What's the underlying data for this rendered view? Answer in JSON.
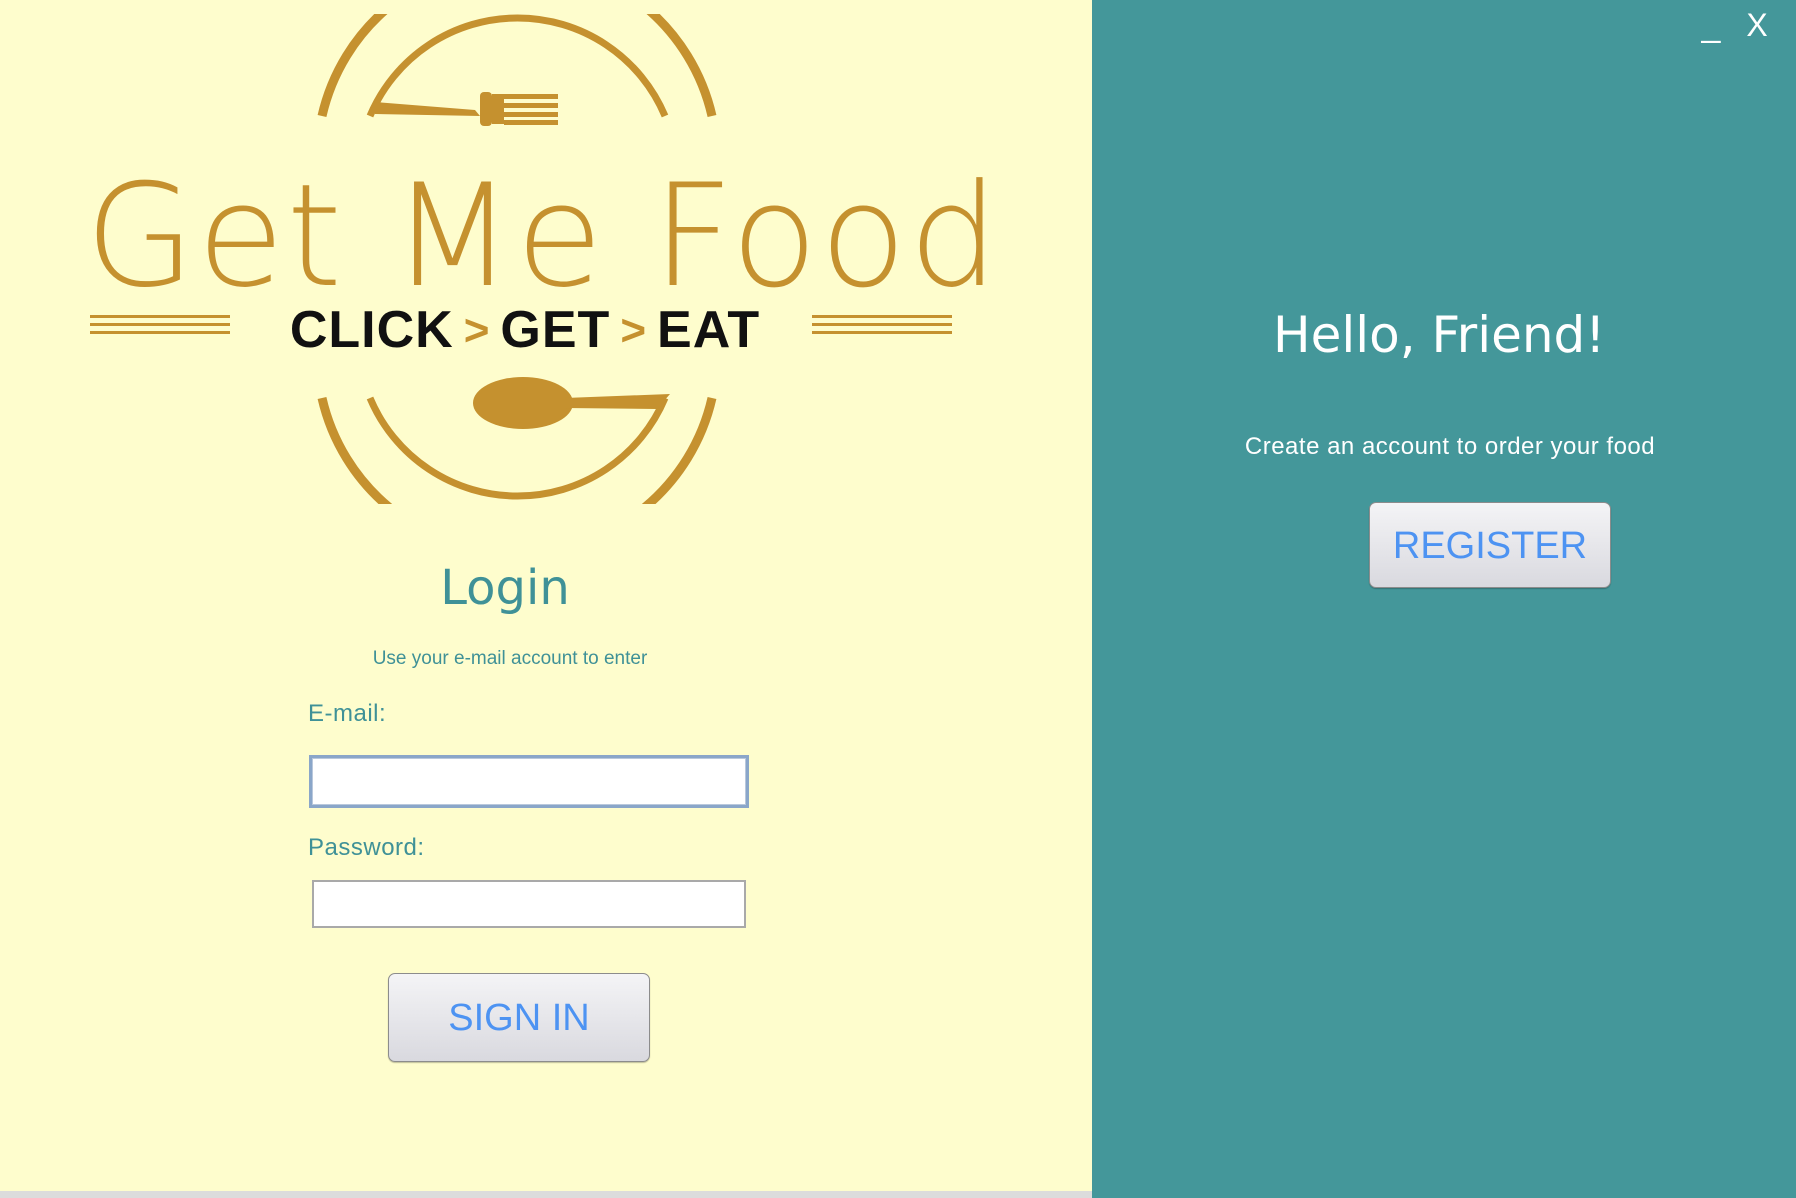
{
  "brand": {
    "name": "Get Me Food",
    "tagline_parts": [
      "CLICK",
      "GET",
      "EAT"
    ],
    "accent_color": "#c5912f"
  },
  "login": {
    "title": "Login",
    "subtitle": "Use your e-mail account to enter",
    "email_label": "E-mail:",
    "email_value": "",
    "password_label": "Password:",
    "password_value": "",
    "signin_label": "SIGN IN"
  },
  "register_panel": {
    "greeting": "Hello, Friend!",
    "message": "Create an account to order your food",
    "register_label": "REGISTER",
    "background_color": "#44979a"
  },
  "window_controls": {
    "minimize_glyph": "_",
    "close_glyph": "X"
  },
  "icons": [
    "fork-icon",
    "spoon-icon",
    "chevron-right-icon"
  ]
}
